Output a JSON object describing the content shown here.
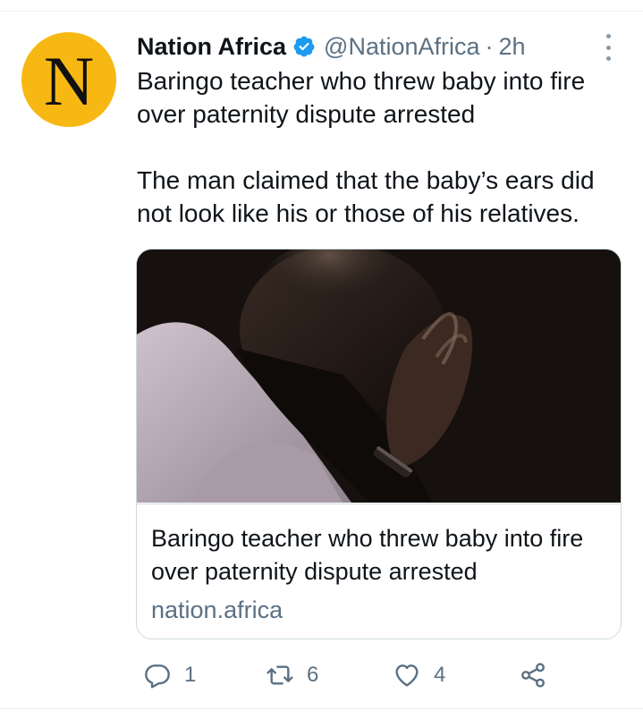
{
  "tweet": {
    "avatar_letter": "N",
    "avatar_color": "#f7b813",
    "display_name": "Nation Africa",
    "handle": "@NationAfrica",
    "separator": "·",
    "time": "2h",
    "verified_icon": "verified-badge-icon",
    "text_line1": "Baringo teacher who threw baby into fire over paternity dispute arrested",
    "text_line2": "The man claimed that the baby’s ears did not look like his or those of his relatives."
  },
  "card": {
    "image": "photo of man with head bowed, hands clasped",
    "title": "Baringo teacher who threw baby into fire over paternity dispute arrested",
    "domain": "nation.africa"
  },
  "actions": {
    "reply_count": "1",
    "retweet_count": "6",
    "like_count": "4"
  },
  "colors": {
    "text": "#0f1419",
    "secondary": "#5b7083",
    "verified": "#1d9bf0",
    "border": "#cfd9de"
  }
}
